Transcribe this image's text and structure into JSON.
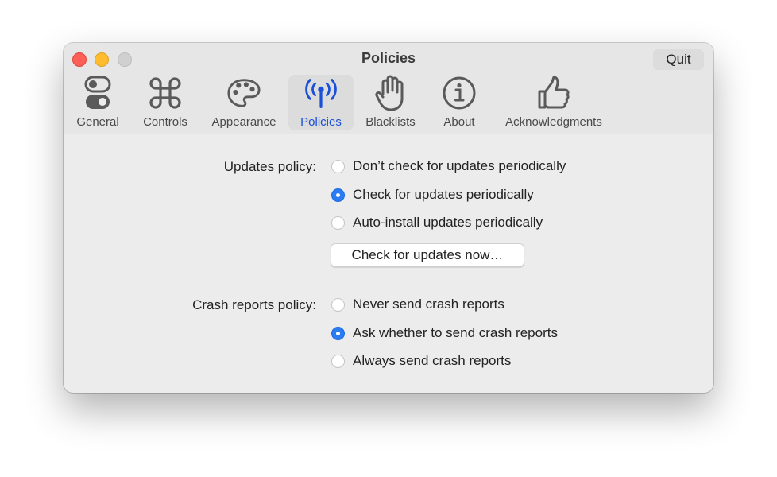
{
  "window": {
    "title": "Policies",
    "quit_label": "Quit"
  },
  "tabs": [
    {
      "label": "General",
      "icon": "toggles-icon"
    },
    {
      "label": "Controls",
      "icon": "command-icon"
    },
    {
      "label": "Appearance",
      "icon": "palette-icon"
    },
    {
      "label": "Policies",
      "icon": "antenna-icon",
      "selected": true
    },
    {
      "label": "Blacklists",
      "icon": "hand-icon"
    },
    {
      "label": "About",
      "icon": "info-icon"
    },
    {
      "label": "Acknowledgments",
      "icon": "thumbs-up-icon"
    }
  ],
  "updates": {
    "label": "Updates policy:",
    "options": [
      "Don’t check for updates periodically",
      "Check for updates periodically",
      "Auto-install updates periodically"
    ],
    "selected": 1,
    "check_now_label": "Check for updates now…"
  },
  "crash": {
    "label": "Crash reports policy:",
    "options": [
      "Never send crash reports",
      "Ask whether to send crash reports",
      "Always send crash reports"
    ],
    "selected": 1
  },
  "colors": {
    "accent": "#2a7cf2",
    "selected_tab_text": "#1a4fd8"
  }
}
